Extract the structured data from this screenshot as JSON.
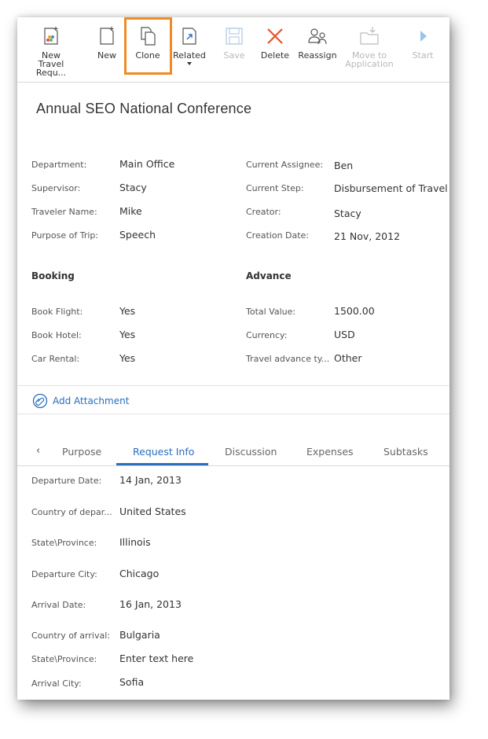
{
  "toolbar": {
    "buttons": [
      {
        "label": "New\nTravel Requ...",
        "icon": "new-request-icon"
      },
      {
        "label": "New",
        "icon": "new-document-icon"
      },
      {
        "label": "Clone",
        "icon": "clone-icon"
      },
      {
        "label": "Related",
        "icon": "related-link-icon"
      },
      {
        "label": "Save",
        "icon": "save-icon",
        "disabled": true
      },
      {
        "label": "Delete",
        "icon": "delete-icon"
      },
      {
        "label": "Reassign",
        "icon": "reassign-icon"
      },
      {
        "label": "Move to\nApplication",
        "icon": "move-to-application-icon",
        "disabled": true
      },
      {
        "label": "Start",
        "icon": "start-icon",
        "disabled": true
      }
    ]
  },
  "title": "Annual  SEO National Conference",
  "general": {
    "left": [
      {
        "label": "Department:",
        "value": "Main Office"
      },
      {
        "label": "Supervisor:",
        "value": "Stacy"
      },
      {
        "label": "Traveler Name:",
        "value": "Mike"
      },
      {
        "label": "Purpose of Trip:",
        "value": "Speech"
      }
    ],
    "right": [
      {
        "label": "Current Assignee:",
        "value": "Ben"
      },
      {
        "label": "Current Step:",
        "value": "Disbursement of Travel"
      },
      {
        "label": "Creator:",
        "value": "Stacy"
      },
      {
        "label": "Creation Date:",
        "value": "21 Nov, 2012"
      }
    ]
  },
  "booking": {
    "heading": "Booking",
    "rows": [
      {
        "label": "Book Flight:",
        "value": "Yes"
      },
      {
        "label": "Book Hotel:",
        "value": "Yes"
      },
      {
        "label": "Car Rental:",
        "value": "Yes"
      }
    ]
  },
  "advance": {
    "heading": "Advance",
    "rows": [
      {
        "label": "Total Value:",
        "value": "1500.00"
      },
      {
        "label": "Currency:",
        "value": "USD"
      },
      {
        "label": "Travel advance ty...",
        "value": "Other"
      }
    ]
  },
  "attachment": {
    "label": "Add Attachment"
  },
  "tabs": {
    "prev": "‹",
    "items": [
      "Purpose",
      "Request Info",
      "Discussion",
      "Expenses",
      "Subtasks"
    ],
    "active": "Request Info"
  },
  "request_info": [
    {
      "label": "Departure Date:",
      "value": "14 Jan, 2013"
    },
    {
      "label": "Country of depar...",
      "value": "United States"
    },
    {
      "label": "State\\Province:",
      "value": "Illinois"
    },
    {
      "label": "Departure City:",
      "value": "Chicago"
    },
    {
      "label": "Arrival Date:",
      "value": "16 Jan, 2013"
    },
    {
      "label": "Country of arrival:",
      "value": "Bulgaria"
    },
    {
      "label": "State\\Province:",
      "value": "Enter text here"
    },
    {
      "label": "Arrival City:",
      "value": "Sofia"
    }
  ],
  "colors": {
    "accent": "#2a6ebb",
    "highlight": "#f08a24",
    "delete": "#e8532a"
  }
}
